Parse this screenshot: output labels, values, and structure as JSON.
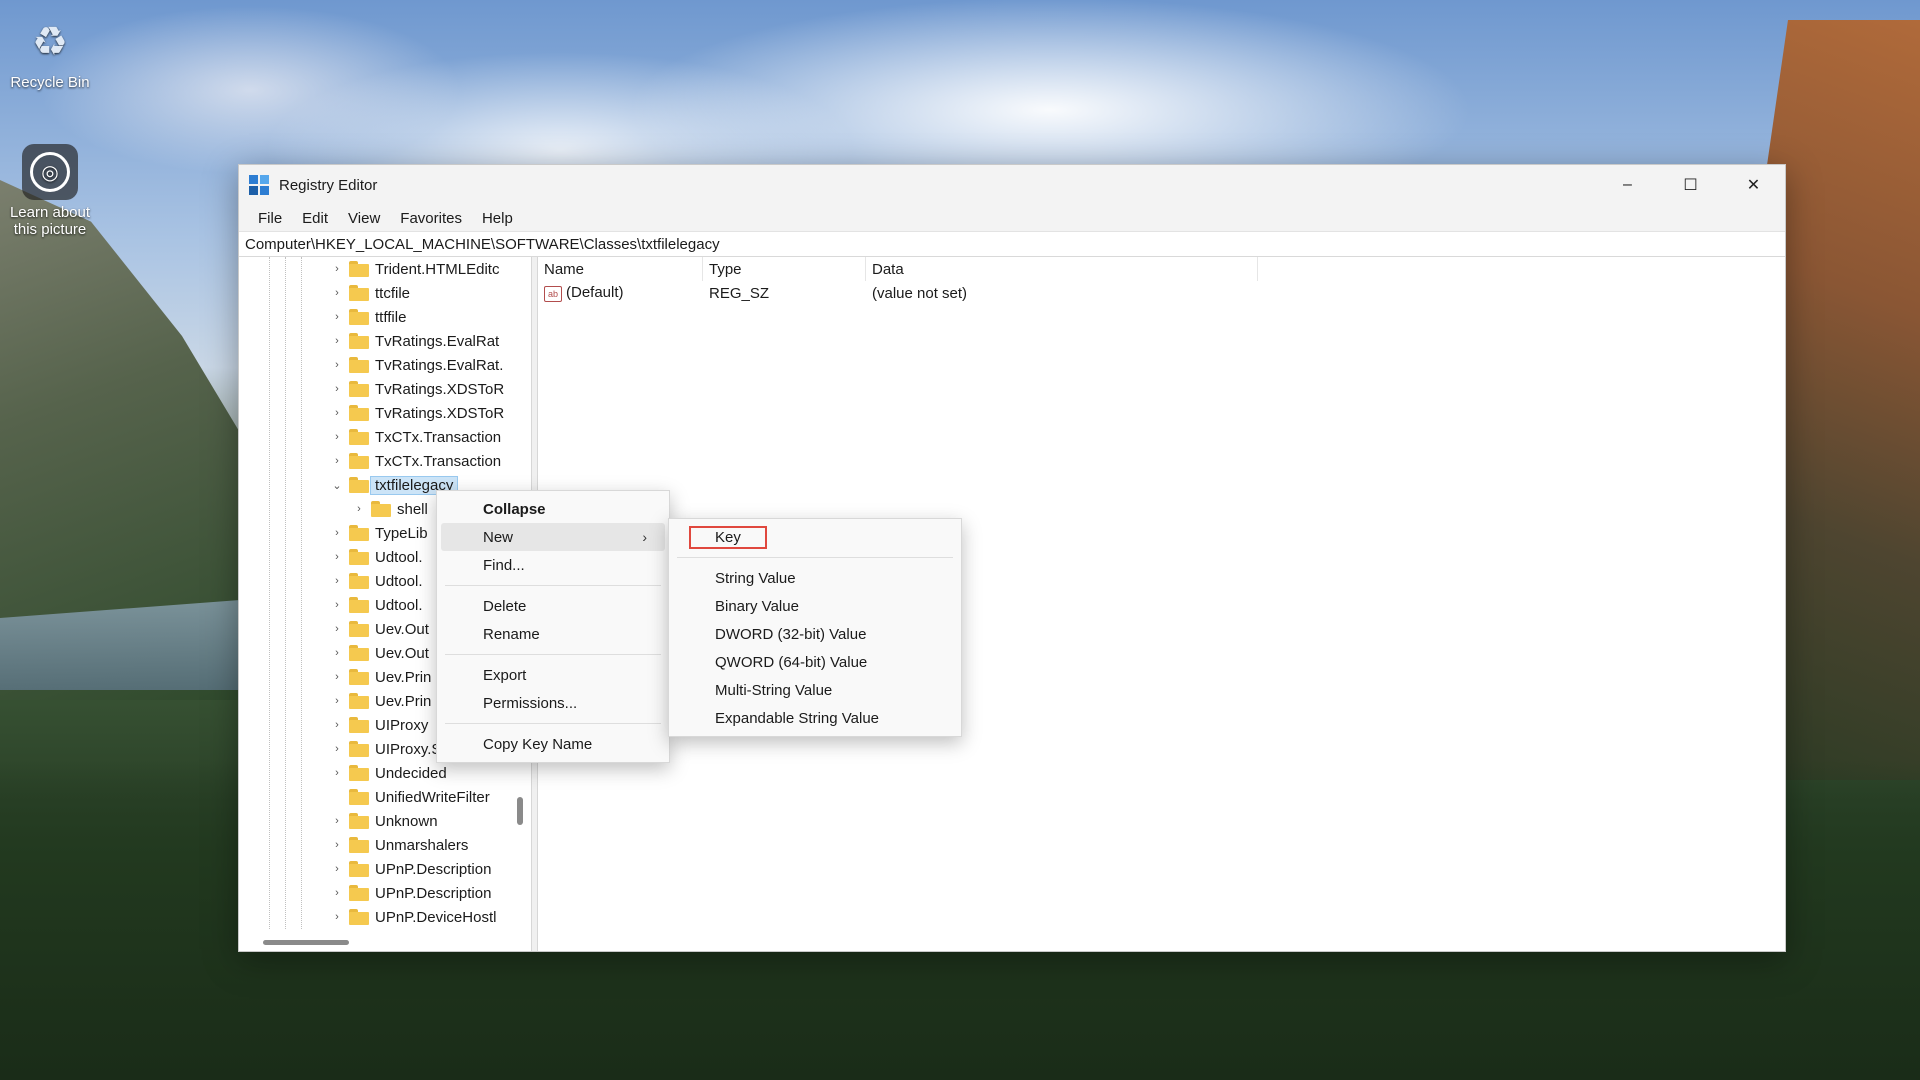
{
  "desktop": {
    "recycle_bin_label": "Recycle Bin",
    "learn_label_line1": "Learn about",
    "learn_label_line2": "this picture"
  },
  "window": {
    "title": "Registry Editor",
    "controls": {
      "minimize": "–",
      "maximize": "☐",
      "close": "✕"
    },
    "menu": [
      "File",
      "Edit",
      "View",
      "Favorites",
      "Help"
    ],
    "address": "Computer\\HKEY_LOCAL_MACHINE\\SOFTWARE\\Classes\\txtfilelegacy"
  },
  "tree": {
    "items": [
      "Trident.HTMLEditc",
      "ttcfile",
      "ttffile",
      "TvRatings.EvalRat",
      "TvRatings.EvalRat.",
      "TvRatings.XDSToR",
      "TvRatings.XDSToR",
      "TxCTx.Transaction",
      "TxCTx.Transaction",
      "txtfilelegacy",
      "shell",
      "TypeLib",
      "Udtool.",
      "Udtool.",
      "Udtool.",
      "Uev.Out",
      "Uev.Out",
      "Uev.Prin",
      "Uev.Prin",
      "UIProxy",
      "UIProxy.SvWrappe",
      "Undecided",
      "UnifiedWriteFilter",
      "Unknown",
      "Unmarshalers",
      "UPnP.Description",
      "UPnP.Description",
      "UPnP.DeviceHostl"
    ]
  },
  "list": {
    "headers": {
      "name": "Name",
      "type": "Type",
      "data": "Data"
    },
    "rows": [
      {
        "name": "(Default)",
        "type": "REG_SZ",
        "data": "(value not set)"
      }
    ]
  },
  "context_menu": {
    "collapse": "Collapse",
    "new": "New",
    "find": "Find...",
    "delete": "Delete",
    "rename": "Rename",
    "export": "Export",
    "permissions": "Permissions...",
    "copy_key_name": "Copy Key Name"
  },
  "submenu": {
    "key": "Key",
    "string_value": "String Value",
    "binary_value": "Binary Value",
    "dword_value": "DWORD (32-bit) Value",
    "qword_value": "QWORD (64-bit) Value",
    "multi_string_value": "Multi-String Value",
    "expandable_string_value": "Expandable String Value"
  },
  "colors": {
    "highlight_box": "#e0483e",
    "selection": "#cce4f7",
    "folder": "#f5c94f"
  }
}
